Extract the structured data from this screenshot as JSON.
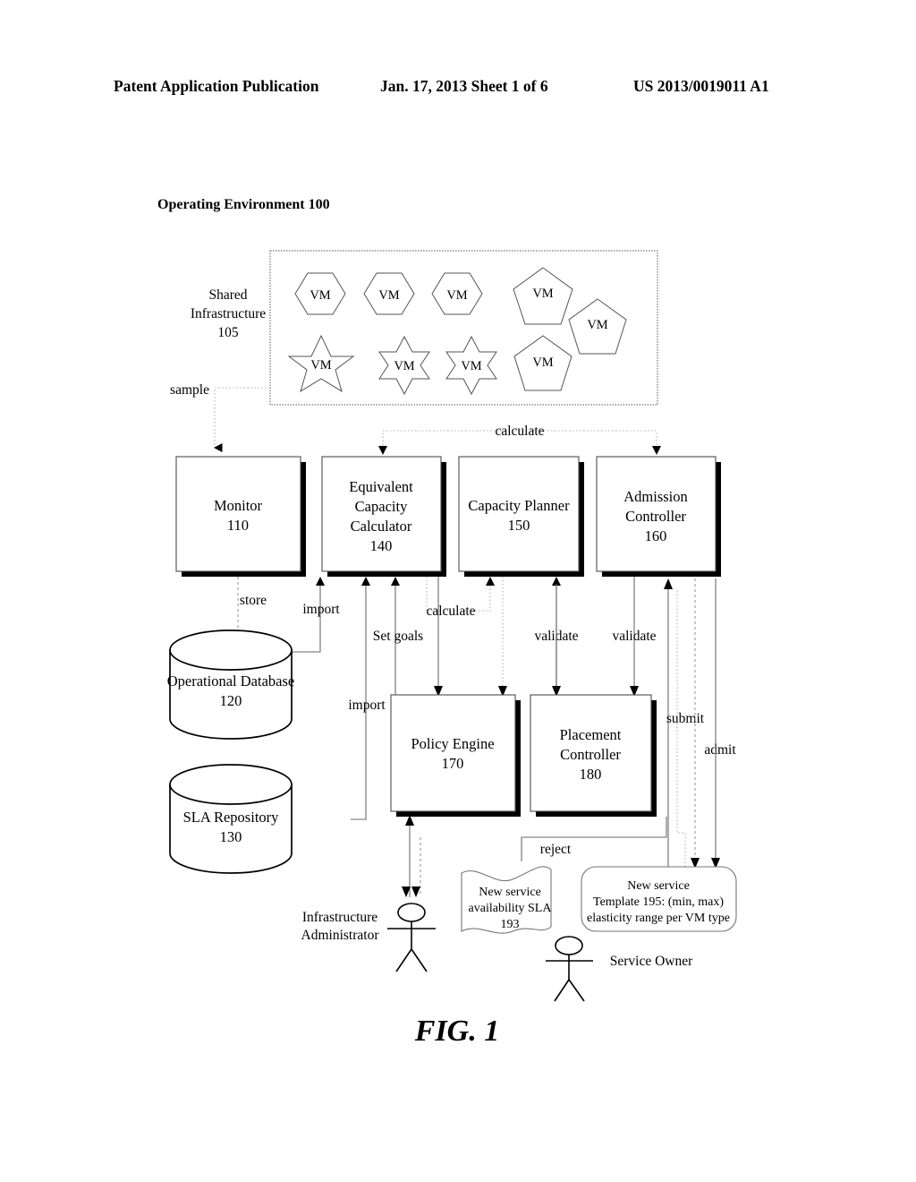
{
  "header": {
    "publication": "Patent Application Publication",
    "date_sheet": "Jan. 17, 2013   Sheet 1 of 6",
    "number": "US 2013/0019011 A1"
  },
  "figure": {
    "caption": "FIG. 1",
    "diagram_title": "Operating Environment 100"
  },
  "shared_infrastructure": {
    "label_line1": "Shared",
    "label_line2": "Infrastructure",
    "label_line3": "105",
    "vm_label": "VM",
    "vms": [
      {
        "id": "vm-hex-1",
        "shape": "hexagon",
        "label": "VM"
      },
      {
        "id": "vm-hex-2",
        "shape": "hexagon",
        "label": "VM"
      },
      {
        "id": "vm-hex-3",
        "shape": "hexagon",
        "label": "VM"
      },
      {
        "id": "vm-pent-1",
        "shape": "pentagon",
        "label": "VM"
      },
      {
        "id": "vm-pent-2",
        "shape": "pentagon",
        "label": "VM"
      },
      {
        "id": "vm-star5-1",
        "shape": "star5",
        "label": "VM"
      },
      {
        "id": "vm-star6-1",
        "shape": "star6",
        "label": "VM"
      },
      {
        "id": "vm-star6-2",
        "shape": "star6",
        "label": "VM"
      },
      {
        "id": "vm-pent-3",
        "shape": "pentagon",
        "label": "VM"
      }
    ]
  },
  "components": {
    "monitor": {
      "name": "Monitor",
      "ref": "110"
    },
    "ecc": {
      "name_line1": "Equivalent",
      "name_line2": "Capacity",
      "name_line3": "Calculator",
      "ref": "140"
    },
    "planner": {
      "name": "Capacity Planner",
      "ref": "150"
    },
    "admission": {
      "name_line1": "Admission",
      "name_line2": "Controller",
      "ref": "160"
    },
    "opdb": {
      "name": "Operational Database",
      "ref": "120"
    },
    "sla_repo": {
      "name": "SLA Repository",
      "ref": "130"
    },
    "policy": {
      "name": "Policy Engine",
      "ref": "170"
    },
    "placement": {
      "name_line1": "Placement",
      "name_line2": "Controller",
      "ref": "180"
    }
  },
  "actors": {
    "infrastructure_admin": {
      "line1": "Infrastructure",
      "line2": "Administrator"
    },
    "service_owner": {
      "line1": "Service Owner"
    }
  },
  "artifacts": {
    "sla_doc": {
      "line1": "New service",
      "line2": "availability SLA",
      "line3": "193"
    },
    "template_doc": {
      "line1": "New service",
      "line2": "Template 195: (min, max)",
      "line3": "elasticity range per VM type"
    }
  },
  "edges": [
    {
      "id": "edge-sample",
      "label": "sample"
    },
    {
      "id": "edge-calculate-top",
      "label": "calculate"
    },
    {
      "id": "edge-store",
      "label": "store"
    },
    {
      "id": "edge-import-1",
      "label": "import"
    },
    {
      "id": "edge-import-2",
      "label": "import"
    },
    {
      "id": "edge-calculate-b",
      "label": "calculate"
    },
    {
      "id": "edge-set-goals",
      "label": "Set goals"
    },
    {
      "id": "edge-validate-1",
      "label": "validate"
    },
    {
      "id": "edge-validate-2",
      "label": "validate"
    },
    {
      "id": "edge-submit",
      "label": "submit"
    },
    {
      "id": "edge-admit",
      "label": "admit"
    },
    {
      "id": "edge-reject",
      "label": "reject"
    }
  ],
  "colors": {
    "ink": "#000000",
    "paper": "#ffffff",
    "connector": "#6b6b6b",
    "shape_stroke": "#555555"
  }
}
